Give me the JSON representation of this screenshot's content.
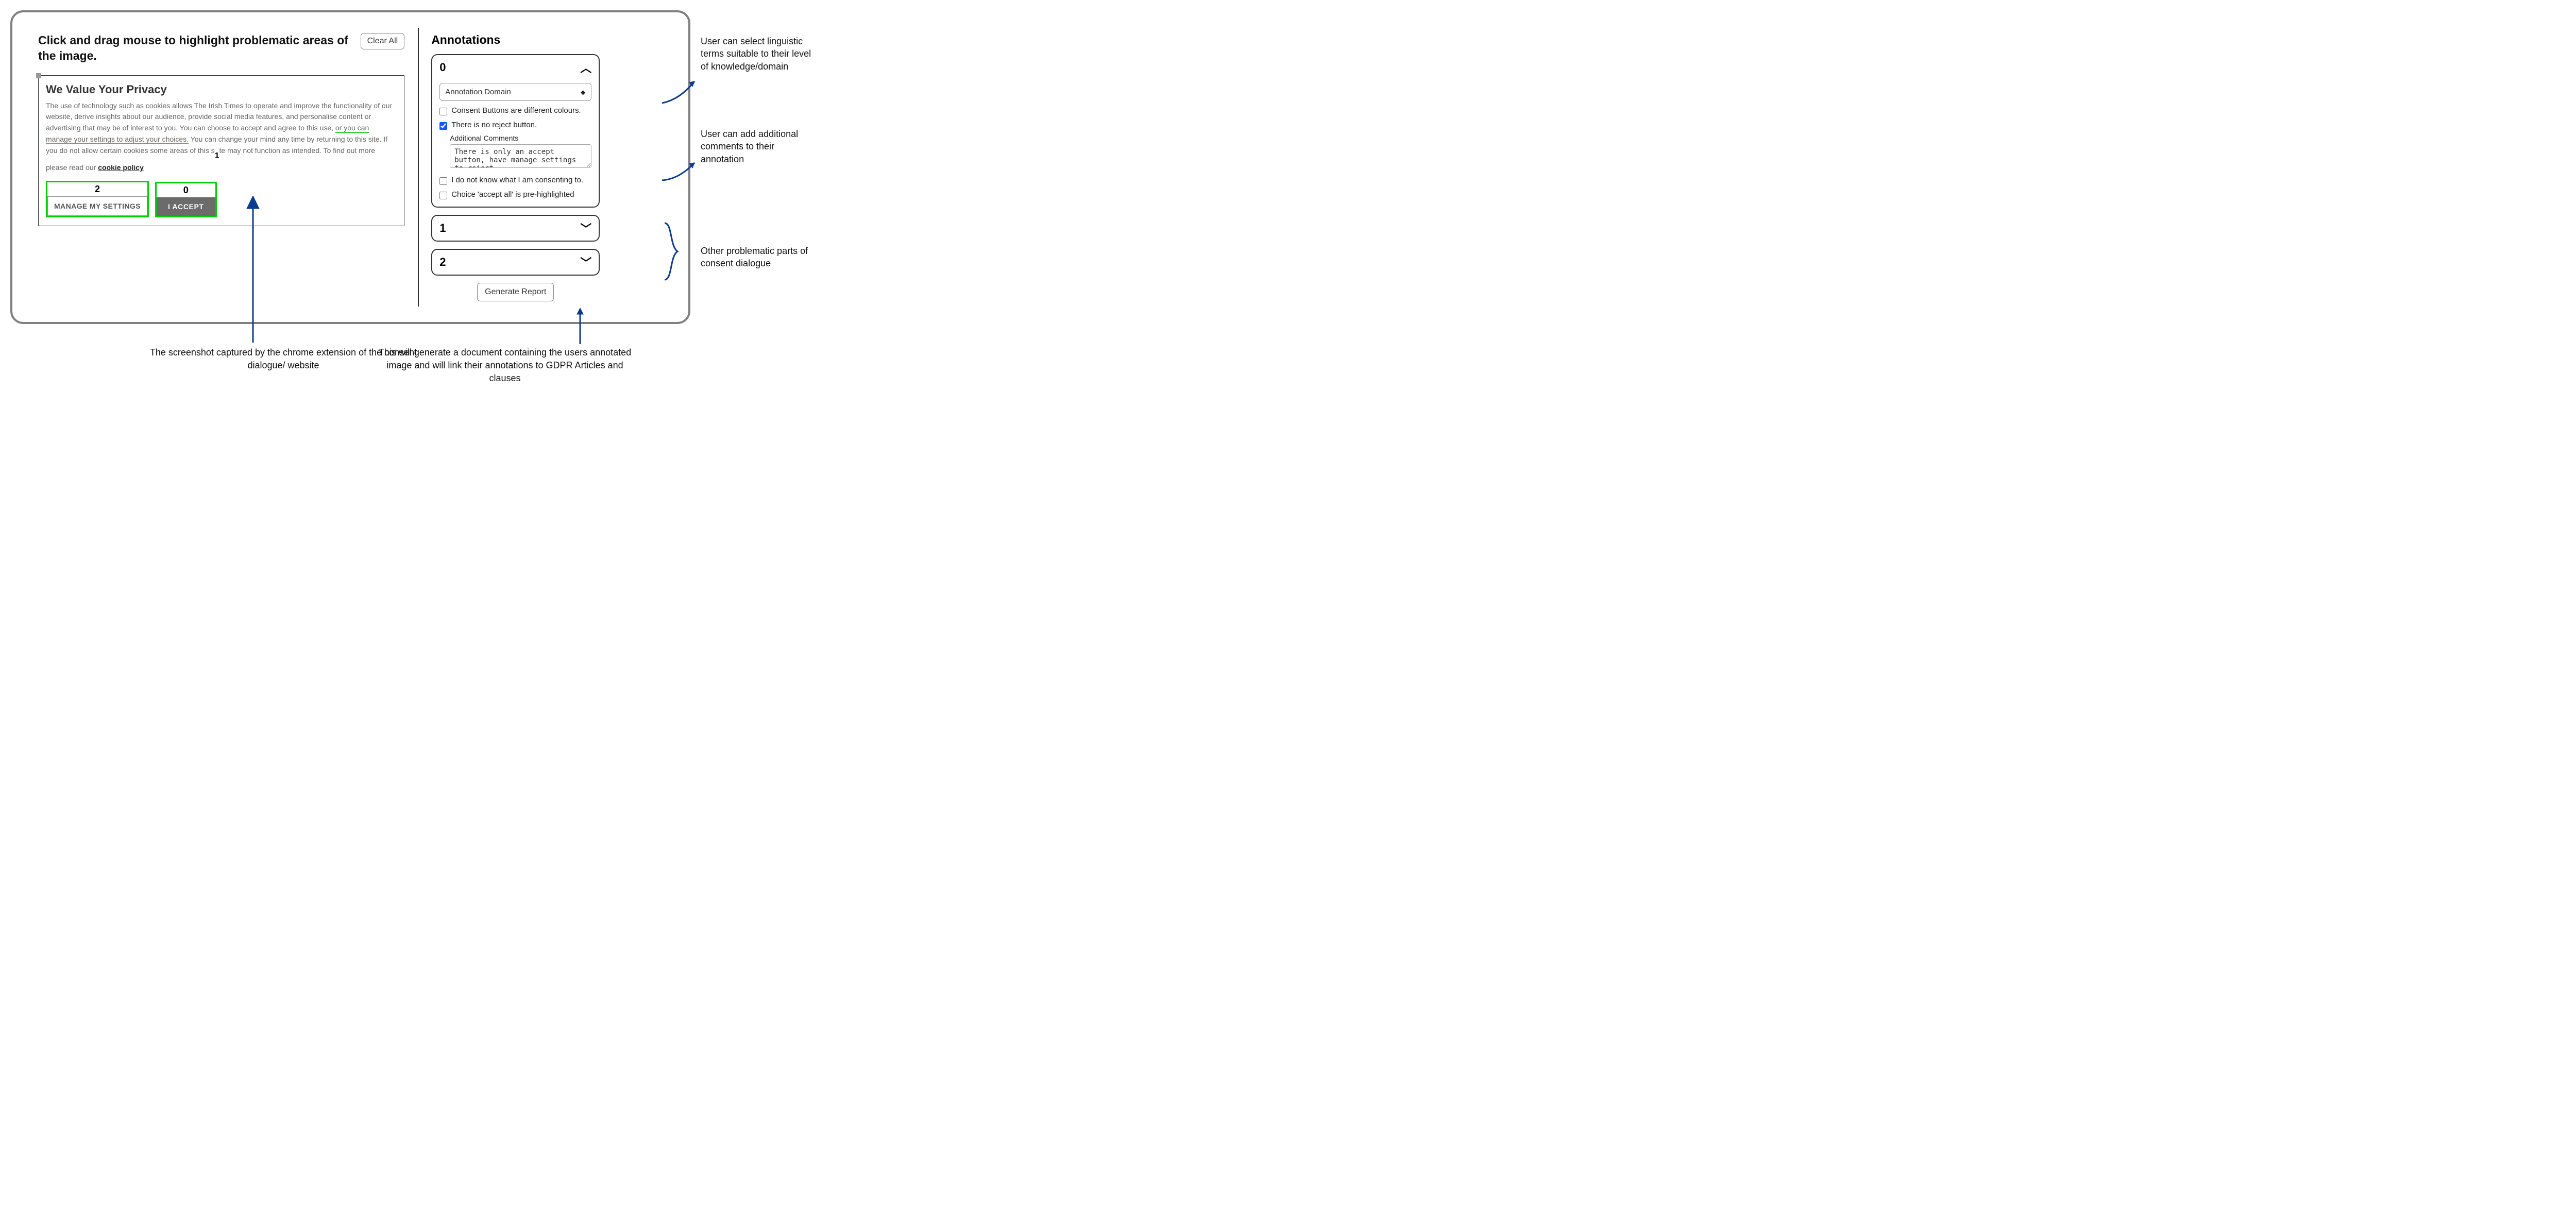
{
  "left": {
    "instruction": "Click and drag mouse to highlight problematic areas of the image.",
    "clear_label": "Clear All",
    "consent": {
      "title": "We Value Your Privacy",
      "text_a": "The use of technology such as cookies allows The Irish Times to operate and improve the functionality of our website, derive insights about our audience, provide social media features, and personalise content or advertising that may be of interest to you. You can choose to accept and agree to this use, ",
      "text_underline": "or you can manage your settings to adjust your choices.",
      "text_b": " You can change your mind any time by returning to this site. If you do not allow certain cookies some areas of this s",
      "num1": "1",
      "text_c": "te may not function as intended. To find out more please read our ",
      "cookie_policy": "cookie policy",
      "manage_num": "2",
      "manage_label": "MANAGE MY SETTINGS",
      "accept_num": "0",
      "accept_label": "I ACCEPT"
    }
  },
  "right": {
    "title": "Annotations",
    "cards": {
      "open": {
        "num": "0",
        "domain_placeholder": "Annotation Domain",
        "checks": [
          {
            "label": "Consent Buttons are different colours.",
            "checked": false
          },
          {
            "label": "There is no reject button.",
            "checked": true
          }
        ],
        "additional_label": "Additional Comments",
        "additional_text": "There is only an accept button, have manage settings to reject",
        "checks_after": [
          {
            "label": "I do not know what I am consenting to.",
            "checked": false
          },
          {
            "label": "Choice 'accept all' is pre-highlighted",
            "checked": false
          }
        ]
      },
      "collapsed": [
        {
          "num": "1"
        },
        {
          "num": "2"
        }
      ]
    },
    "generate_label": "Generate Report"
  },
  "callouts": {
    "c1": "User can select linguistic terms suitable to their level of knowledge/domain",
    "c2": "User can add additional comments to their annotation",
    "c3": "Other problematic parts of consent dialogue",
    "cap1": "The screenshot captured by the chrome extension of the consent dialogue/ website",
    "cap2": "This will generate a document containing the users annotated image and will link their annotations to GDPR Articles and clauses"
  }
}
